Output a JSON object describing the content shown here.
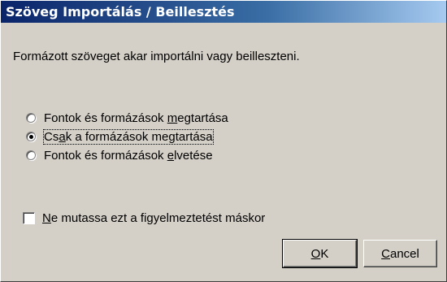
{
  "dialog": {
    "title": "Szöveg Importálás / Beillesztés",
    "message": "Formázott szöveget akar importálni vagy beilleszteni."
  },
  "options": [
    {
      "pre": "Fontok és formázások ",
      "key": "m",
      "post": "egtartása",
      "selected": false
    },
    {
      "pre": "Cs",
      "key": "a",
      "post": "k a formázások megtartása",
      "selected": true
    },
    {
      "pre": "Fontok és formázások ",
      "key": "e",
      "post": "lvetése",
      "selected": false
    }
  ],
  "checkbox": {
    "key": "N",
    "rest": "e mutassa ezt a figyelmeztetést máskor",
    "checked": false
  },
  "buttons": {
    "ok_key": "O",
    "ok_rest": "K",
    "cancel_key": "C",
    "cancel_rest": "ancel"
  }
}
